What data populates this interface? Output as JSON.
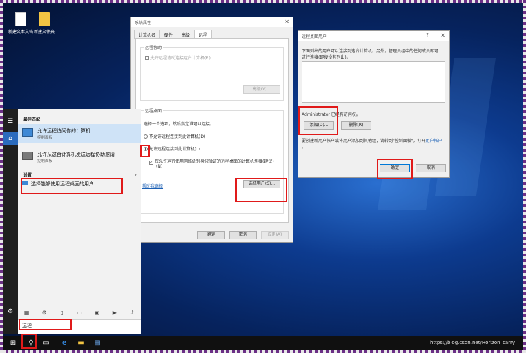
{
  "desktop": {
    "icons": [
      {
        "label": "新建文本文档",
        "icon": "text-document-icon"
      },
      {
        "label": "新建文件夹",
        "icon": "folder-icon"
      }
    ],
    "watermark": "https://blog.csdn.net/Horizon_carry"
  },
  "system_properties": {
    "title": "系统属性",
    "tabs": [
      "计算机名",
      "硬件",
      "高级",
      "远程"
    ],
    "active_tab": "远程",
    "remote_assistance": {
      "group_title": "远程协助",
      "allow_checkbox": "允许远程协助连接这台计算机(R)",
      "advanced_button": "高级(V)..."
    },
    "remote_desktop": {
      "group_title": "远程桌面",
      "instruction": "选择一个选项，然后指定谁可以连接。",
      "option_disallow": "不允许远程连接到此计算机(D)",
      "option_allow": "允许远程连接到此计算机(L)",
      "nla_checkbox_line1": "仅允许运行使用网络级别身份验证的远程桌面的计算机连接(建议)",
      "nla_checkbox_line2": "(N)",
      "help_link": "帮助我选择",
      "select_users_button": "选择用户(S)..."
    },
    "buttons": {
      "ok": "确定",
      "cancel": "取消",
      "apply": "应用(A)"
    }
  },
  "remote_users_dialog": {
    "title": "远程桌面用户",
    "help_glyph": "?",
    "intro_line1": "下面列出的用户可以连接到这台计算机。另外，管理员组中的任何成员即可",
    "intro_line2": "进行连接(即便没有列出)。",
    "access_note": "Administrator 已经有访问权。",
    "add_button": "添加(D)...",
    "remove_button": "删除(R)",
    "create_note_prefix": "要创建新用户帐户或将用户添加到其他组，请转到\"控制面板\"，打开",
    "create_note_link": "用户帐户",
    "create_note_suffix": "。",
    "ok_button": "确定",
    "cancel_button": "取消"
  },
  "start_menu": {
    "best_match_title": "最佳匹配",
    "results": [
      {
        "title": "允许远程访问你的计算机",
        "subtitle": "控制面板",
        "selected": true
      },
      {
        "title": "允许从这台计算机发送远程协助邀请",
        "subtitle": "控制面板",
        "selected": false
      }
    ],
    "settings_title": "设置",
    "settings_item": "选择能够使用远程桌面的用户",
    "search_text": "远程",
    "filter_icons": [
      "apps-icon",
      "settings-icon",
      "document-icon",
      "tablet-icon",
      "photo-icon",
      "video-icon",
      "music-icon"
    ]
  },
  "taskbar": {
    "icons": [
      "windows-start-icon",
      "search-icon",
      "task-view-icon",
      "edge-icon",
      "file-explorer-icon",
      "store-icon"
    ]
  },
  "colors": {
    "highlight_red": "#e01a1a",
    "selection_blue": "#cfe3f7",
    "taskbar": "#101010"
  }
}
